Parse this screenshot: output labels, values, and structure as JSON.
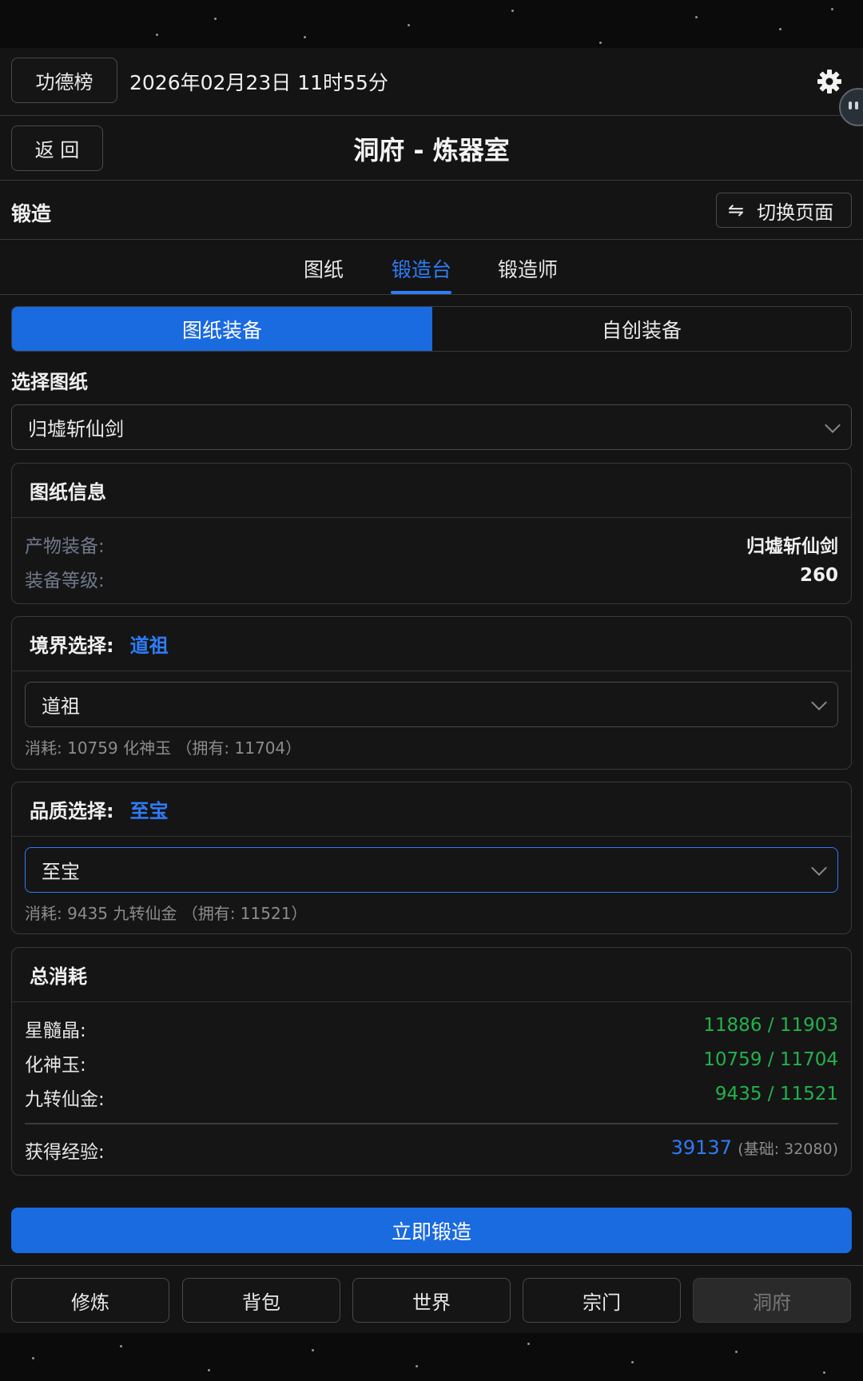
{
  "header": {
    "merit_button": "功德榜",
    "datetime": "2026年02月23日 11时55分",
    "settings_icon": "gear-icon"
  },
  "nav": {
    "back_button": "返 回",
    "page_title": "洞府 - 炼器室"
  },
  "section": {
    "title": "锻造",
    "switch_button": "切换页面",
    "switch_icon": "swap-arrows-icon"
  },
  "tabs": [
    {
      "label": "图纸",
      "active": false
    },
    {
      "label": "锻造台",
      "active": true
    },
    {
      "label": "锻造师",
      "active": false
    }
  ],
  "mode_toggle": {
    "options": [
      "图纸装备",
      "自创装备"
    ],
    "selected": "图纸装备"
  },
  "blueprint": {
    "label": "选择图纸",
    "selected": "归墟斩仙剑"
  },
  "blueprint_info": {
    "title": "图纸信息",
    "rows": [
      {
        "label": "产物装备:",
        "value": "归墟斩仙剑"
      },
      {
        "label": "装备等级:",
        "value": "260"
      }
    ]
  },
  "realm": {
    "title": "境界选择:",
    "highlight": "道祖",
    "selected": "道祖",
    "cost_note": "消耗: 10759 化神玉 （拥有: 11704）"
  },
  "quality": {
    "title": "品质选择:",
    "highlight": "至宝",
    "selected": "至宝",
    "cost_note": "消耗: 9435 九转仙金 （拥有: 11521）"
  },
  "total_cost": {
    "title": "总消耗",
    "rows": [
      {
        "label": "星髓晶:",
        "value": "11886 / 11903"
      },
      {
        "label": "化神玉:",
        "value": "10759 / 11704"
      },
      {
        "label": "九转仙金:",
        "value": "9435 / 11521"
      }
    ],
    "exp_label": "获得经验:",
    "exp_value": "39137",
    "exp_base": "(基础: 32080)"
  },
  "forge_button": "立即锻造",
  "bottom_nav": [
    {
      "label": "修炼",
      "disabled": false
    },
    {
      "label": "背包",
      "disabled": false
    },
    {
      "label": "世界",
      "disabled": false
    },
    {
      "label": "宗门",
      "disabled": false
    },
    {
      "label": "洞府",
      "disabled": true
    }
  ],
  "colors": {
    "accent": "#1a6ae0",
    "accent_text": "#2e7cf6",
    "success": "#22b24c",
    "background": "#141414"
  }
}
